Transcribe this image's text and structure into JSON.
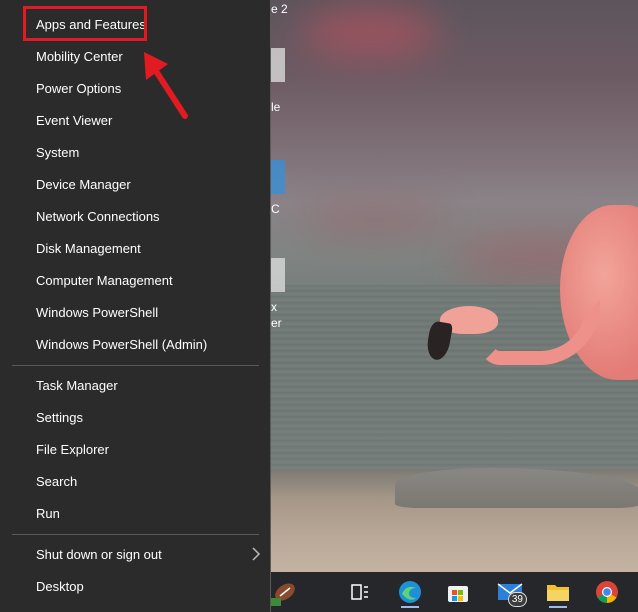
{
  "menu": {
    "items": [
      {
        "label": "Apps and Features"
      },
      {
        "label": "Mobility Center"
      },
      {
        "label": "Power Options"
      },
      {
        "label": "Event Viewer"
      },
      {
        "label": "System"
      },
      {
        "label": "Device Manager"
      },
      {
        "label": "Network Connections"
      },
      {
        "label": "Disk Management"
      },
      {
        "label": "Computer Management"
      },
      {
        "label": "Windows PowerShell"
      },
      {
        "label": "Windows PowerShell (Admin)"
      }
    ],
    "items2": [
      {
        "label": "Task Manager"
      },
      {
        "label": "Settings"
      },
      {
        "label": "File Explorer"
      },
      {
        "label": "Search"
      },
      {
        "label": "Run"
      }
    ],
    "items3": [
      {
        "label": "Shut down or sign out"
      },
      {
        "label": "Desktop"
      }
    ]
  },
  "desktop": {
    "fragments": [
      "e 2",
      "le",
      "C",
      "x",
      "er"
    ]
  },
  "taskbar": {
    "mail_badge": "39"
  },
  "annotation": {
    "highlight_color": "#e21b22"
  }
}
